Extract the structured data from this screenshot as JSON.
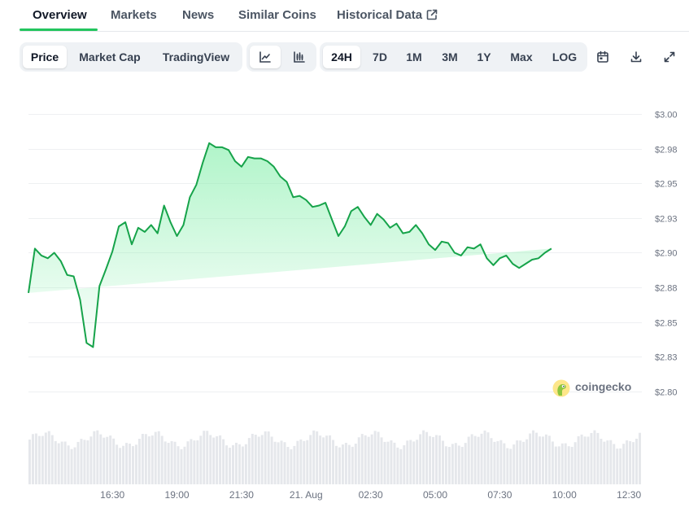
{
  "nav": {
    "tabs": [
      {
        "label": "Overview",
        "active": true
      },
      {
        "label": "Markets"
      },
      {
        "label": "News"
      },
      {
        "label": "Similar Coins"
      },
      {
        "label": "Historical Data",
        "icon": "external-link-icon"
      }
    ]
  },
  "toolbar": {
    "type_buttons": [
      {
        "label": "Price",
        "active": true
      },
      {
        "label": "Market Cap"
      },
      {
        "label": "TradingView"
      }
    ],
    "style_buttons": [
      {
        "icon": "line-chart-icon",
        "active": true
      },
      {
        "icon": "candlestick-chart-icon"
      }
    ],
    "range_buttons": [
      {
        "label": "24H",
        "active": true
      },
      {
        "label": "7D"
      },
      {
        "label": "1M"
      },
      {
        "label": "3M"
      },
      {
        "label": "1Y"
      },
      {
        "label": "Max"
      },
      {
        "label": "LOG"
      }
    ],
    "action_icons": [
      "calendar-icon",
      "download-icon",
      "fullscreen-icon"
    ]
  },
  "brand": {
    "name": "coingecko"
  },
  "colors": {
    "line": "#16a34a",
    "fill_top": "#86efac",
    "volume": "#e5e7eb",
    "grid": "#eef0f2",
    "accent": "#22c55e"
  },
  "chart_data": {
    "type": "area",
    "ylim": [
      2.79,
      3.0
    ],
    "yticks": [
      "$3.00",
      "$2.98",
      "$2.95",
      "$2.93",
      "$2.90",
      "$2.88",
      "$2.85",
      "$2.83",
      "$2.80"
    ],
    "ytick_values": [
      3.0,
      2.975,
      2.95,
      2.925,
      2.9,
      2.875,
      2.85,
      2.825,
      2.8
    ],
    "xticks": [
      "16:30",
      "19:00",
      "21:30",
      "21. Aug",
      "02:30",
      "05:00",
      "07:30",
      "10:00",
      "12:30"
    ],
    "xtick_hours": [
      3.25,
      5.75,
      8.25,
      10.75,
      13.25,
      15.75,
      18.25,
      20.75,
      23.25
    ],
    "x_hours": [
      0,
      0.25,
      0.5,
      0.75,
      1,
      1.25,
      1.5,
      1.75,
      2,
      2.25,
      2.5,
      2.75,
      3,
      3.25,
      3.5,
      3.75,
      4,
      4.25,
      4.5,
      4.75,
      5,
      5.25,
      5.5,
      5.75,
      6,
      6.25,
      6.5,
      6.75,
      7,
      7.25,
      7.5,
      7.75,
      8,
      8.25,
      8.5,
      8.75,
      9,
      9.25,
      9.5,
      9.75,
      10,
      10.25,
      10.5,
      10.75,
      11,
      11.25,
      11.5,
      11.75,
      12,
      12.25,
      12.5,
      12.75,
      13,
      13.25,
      13.5,
      13.75,
      14,
      14.25,
      14.5,
      14.75,
      15,
      15.25,
      15.5,
      15.75,
      16,
      16.25,
      16.5,
      16.75,
      17,
      17.25,
      17.5,
      17.75,
      18,
      18.25,
      18.5,
      18.75,
      19,
      19.25,
      19.5,
      19.75,
      20,
      20.25,
      20.5,
      20.75,
      21,
      21.25,
      21.5,
      21.75,
      22,
      22.25,
      22.5,
      22.75,
      23,
      23.25,
      23.5,
      23.75
    ],
    "price": [
      2.871,
      2.903,
      2.898,
      2.896,
      2.9,
      2.894,
      2.884,
      2.883,
      2.866,
      2.835,
      2.832,
      2.876,
      2.888,
      2.901,
      2.919,
      2.922,
      2.906,
      2.918,
      2.915,
      2.92,
      2.914,
      2.934,
      2.922,
      2.912,
      2.92,
      2.94,
      2.949,
      2.965,
      2.979,
      2.976,
      2.976,
      2.974,
      2.966,
      2.962,
      2.969,
      2.968,
      2.968,
      2.966,
      2.962,
      2.955,
      2.951,
      2.94,
      2.941,
      2.938,
      2.933,
      2.934,
      2.936,
      2.924,
      2.912,
      2.919,
      2.93,
      2.933,
      2.926,
      2.92,
      2.928,
      2.924,
      2.918,
      2.921,
      2.914,
      2.915,
      2.92,
      2.914,
      2.906,
      2.902,
      2.908,
      2.907,
      2.9,
      2.898,
      2.904,
      2.903,
      2.906,
      2.896,
      2.891,
      2.896,
      2.898,
      2.892,
      2.889,
      2.892,
      2.895,
      2.896,
      2.9,
      2.903
    ]
  }
}
